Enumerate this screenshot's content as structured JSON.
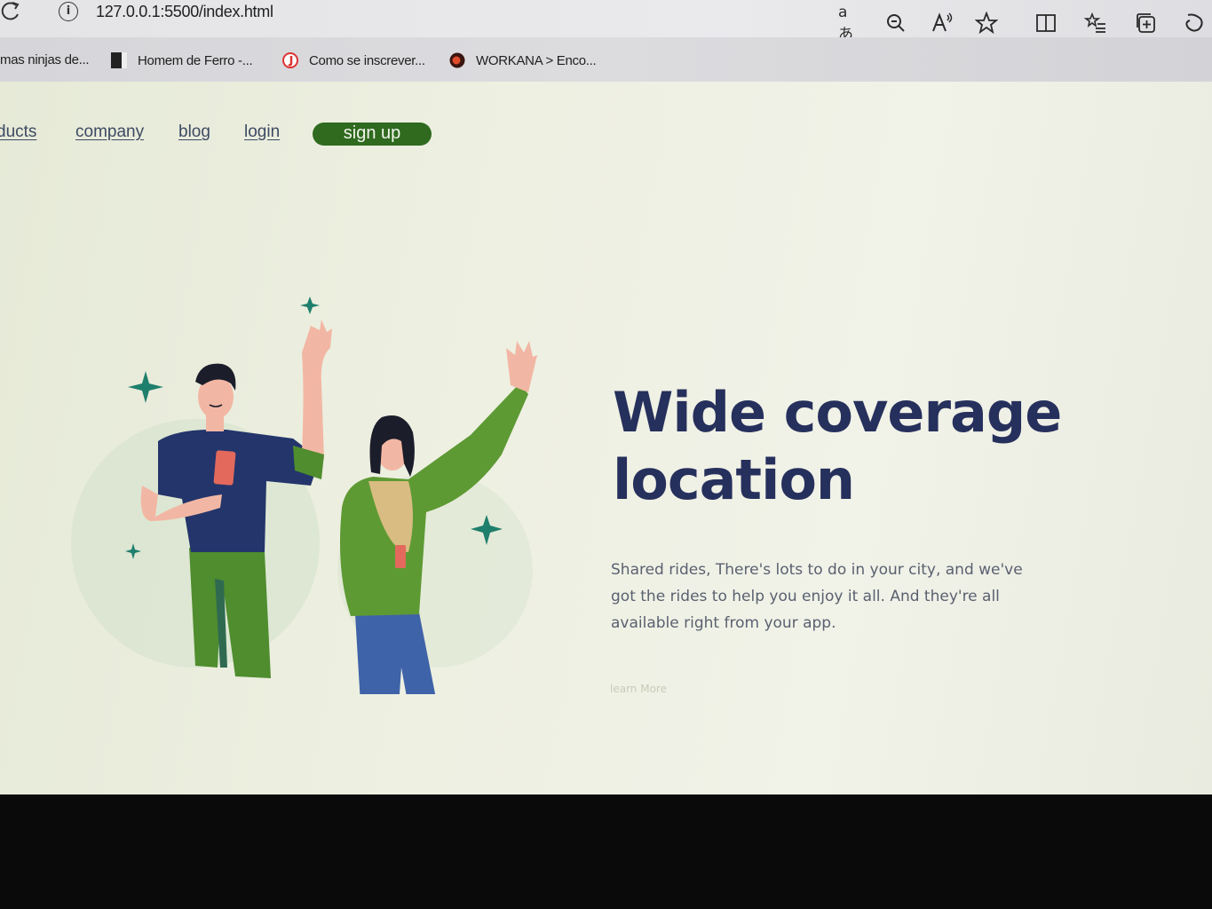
{
  "browser": {
    "url": "127.0.0.1:5500/index.html",
    "info_glyph": "i",
    "bookmarks": [
      {
        "label": "mas ninjas de..."
      },
      {
        "label": "Homem de Ferro -..."
      },
      {
        "label": "Como se inscrever..."
      },
      {
        "label": "WORKANA > Enco..."
      }
    ],
    "toolbar_icons": [
      "translate-icon",
      "zoom-out-icon",
      "read-aloud-icon",
      "favorite-star-icon",
      "split-screen-icon",
      "favorites-list-icon",
      "collections-icon",
      "copilot-icon"
    ],
    "translate_glyph": "aあ"
  },
  "nav": {
    "links": [
      {
        "label": "ducts"
      },
      {
        "label": "company"
      },
      {
        "label": "blog"
      },
      {
        "label": "login"
      }
    ],
    "signup_label": "sign up"
  },
  "hero": {
    "title_line1": "Wide coverage",
    "title_line2": "location",
    "description": "Shared rides, There's lots to do in your city, and we've got the rides to help you enjoy it all. And they're all available right from your app.",
    "learn_more": "learn More"
  },
  "colors": {
    "accent_green": "#2f6a1f",
    "title_navy": "#26305c",
    "sparkle_teal": "#1f7f6d"
  }
}
